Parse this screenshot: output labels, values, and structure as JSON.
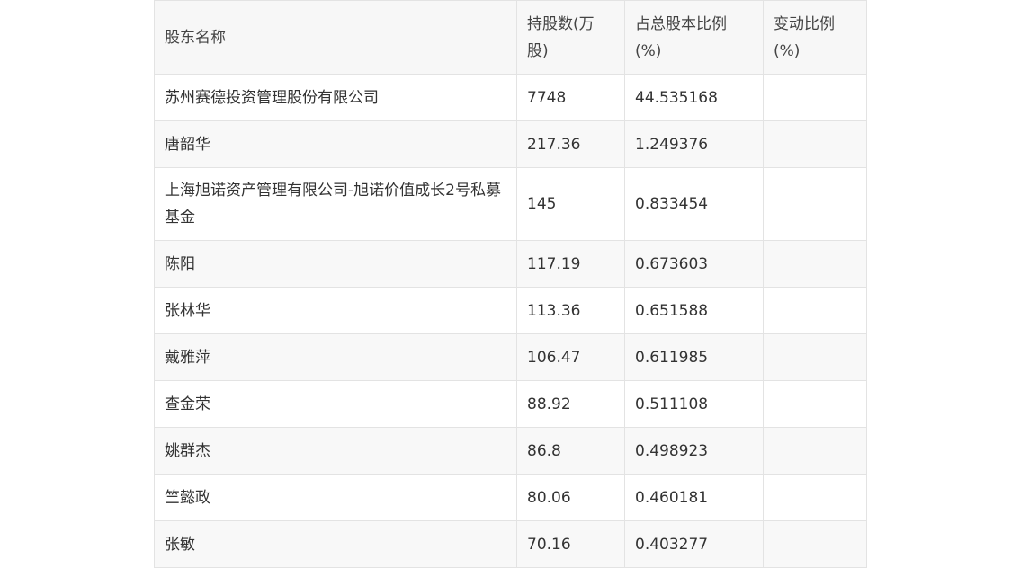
{
  "table": {
    "headers": [
      "股东名称",
      "持股数(万股)",
      "占总股本比例(%)",
      "变动比例(%)"
    ],
    "rows": [
      {
        "name": "苏州赛德投资管理股份有限公司",
        "shares": "7748",
        "ratio": "44.535168",
        "change": ""
      },
      {
        "name": "唐韶华",
        "shares": "217.36",
        "ratio": "1.249376",
        "change": ""
      },
      {
        "name": "上海旭诺资产管理有限公司-旭诺价值成长2号私募基金",
        "shares": "145",
        "ratio": "0.833454",
        "change": ""
      },
      {
        "name": "陈阳",
        "shares": "117.19",
        "ratio": "0.673603",
        "change": ""
      },
      {
        "name": "张林华",
        "shares": "113.36",
        "ratio": "0.651588",
        "change": ""
      },
      {
        "name": "戴雅萍",
        "shares": "106.47",
        "ratio": "0.611985",
        "change": ""
      },
      {
        "name": "查金荣",
        "shares": "88.92",
        "ratio": "0.511108",
        "change": ""
      },
      {
        "name": "姚群杰",
        "shares": "86.8",
        "ratio": "0.498923",
        "change": ""
      },
      {
        "name": "竺懿政",
        "shares": "80.06",
        "ratio": "0.460181",
        "change": ""
      },
      {
        "name": "张敏",
        "shares": "70.16",
        "ratio": "0.403277",
        "change": ""
      }
    ]
  }
}
